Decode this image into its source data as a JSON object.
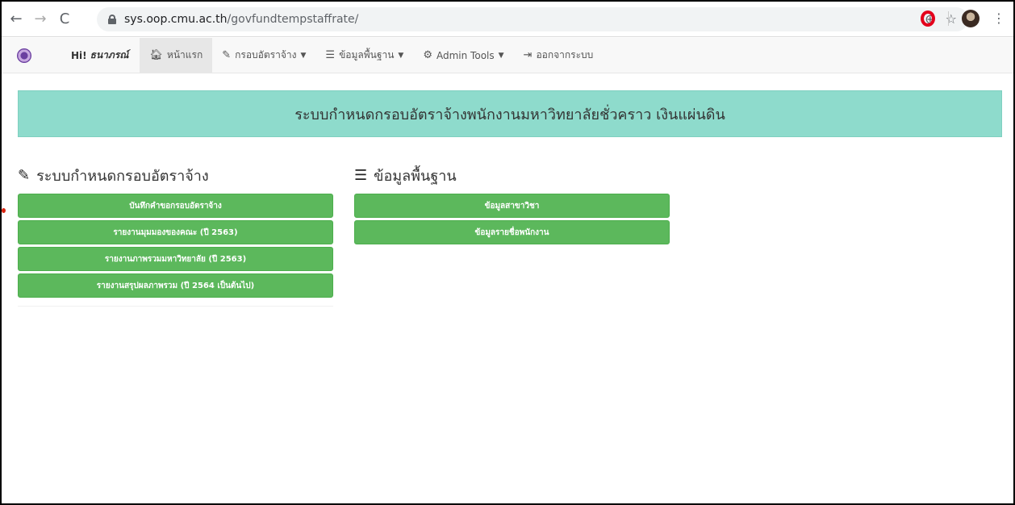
{
  "browser": {
    "url_host": "sys.oop.cmu.ac.th",
    "url_path": "/govfundtempstaffrate/",
    "back_glyph": "←",
    "forward_glyph": "→",
    "reload_glyph": "C",
    "zoom_glyph": "⊕",
    "star_glyph": "☆",
    "menu_glyph": "⋮"
  },
  "navbar": {
    "greeting_hi": "Hi!",
    "user_name": "ธนาภรณ์",
    "items": [
      {
        "icon": "home-icon",
        "glyph": "🏠︎",
        "label": "หน้าแรก",
        "active": true
      },
      {
        "icon": "pencil-icon",
        "glyph": "✎",
        "label": "กรอบอัตราจ้าง",
        "dropdown": true
      },
      {
        "icon": "list-icon",
        "glyph": "☰",
        "label": "ข้อมูลพื้นฐาน",
        "dropdown": true
      },
      {
        "icon": "gear-icon",
        "glyph": "⚙",
        "label": "Admin Tools",
        "dropdown": true
      },
      {
        "icon": "logout-icon",
        "glyph": "⇥",
        "label": "ออกจากระบบ"
      }
    ]
  },
  "banner": {
    "title": "ระบบกำหนดกรอบอัตราจ้างพนักงานมหาวิทยาลัยชั่วคราว เงินแผ่นดิน",
    "color": "#8edbcc"
  },
  "left_section": {
    "icon": "pencil-icon",
    "title": "ระบบกำหนดกรอบอัตราจ้าง",
    "buttons": [
      "บันทึกคำขอกรอบอัตราจ้าง",
      "รายงานมุมมองของคณะ (ปี 2563)",
      "รายงานภาพรวมมหาวิทยาลัย (ปี 2563)",
      "รายงานสรุปผลภาพรวม (ปี 2564 เป็นต้นไป)"
    ]
  },
  "right_section": {
    "icon": "list-icon",
    "title": "ข้อมูลพื้นฐาน",
    "buttons": [
      "ข้อมูลสาขาวิชา",
      "ข้อมูลรายชื่อพนักงาน"
    ]
  },
  "colors": {
    "button_green": "#5cb85c",
    "nav_active": "#e7e7e7"
  }
}
